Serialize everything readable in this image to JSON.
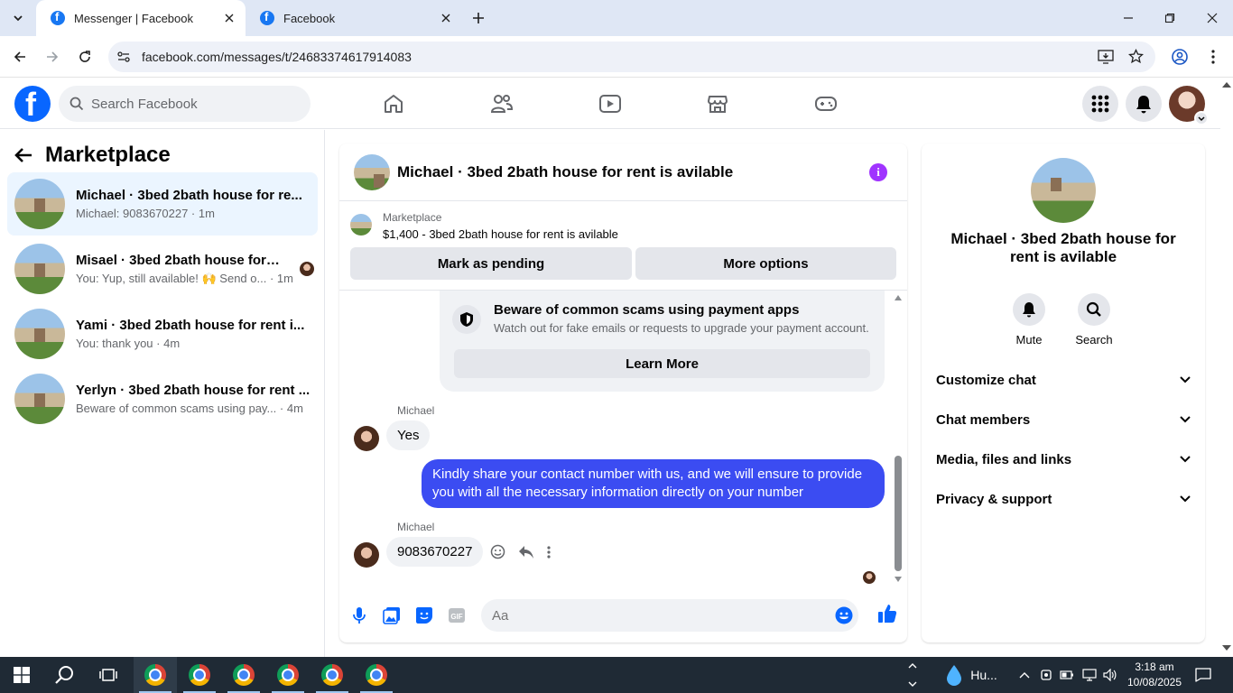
{
  "browser": {
    "tabs": [
      {
        "title": "Messenger | Facebook",
        "active": true
      },
      {
        "title": "Facebook",
        "active": false
      }
    ],
    "url": "facebook.com/messages/t/24683374617914083"
  },
  "header": {
    "search_placeholder": "Search Facebook"
  },
  "sidebar": {
    "title": "Marketplace",
    "conversations": [
      {
        "name": "Michael · 3bed 2bath house for re...",
        "preview": "Michael: 9083670227 · 1m",
        "selected": true
      },
      {
        "name": "Misael · 3bed 2bath house for r...",
        "preview": "You: Yup, still available! 🙌 Send o... · 1m",
        "selected": false
      },
      {
        "name": "Yami · 3bed 2bath house for rent i...",
        "preview": "You: thank you · 4m",
        "selected": false
      },
      {
        "name": "Yerlyn · 3bed 2bath house for rent ...",
        "preview": "Beware of common scams using pay... · 4m",
        "selected": false
      }
    ]
  },
  "chat": {
    "title": "Michael · 3bed 2bath house for rent is avilable",
    "marketplace_label": "Marketplace",
    "listing": "$1,400 - 3bed 2bath house for rent is avilable",
    "mark_pending": "Mark as pending",
    "more_options": "More options",
    "scam_title": "Beware of common scams using payment apps",
    "scam_body": "Watch out for fake emails or requests to upgrade your payment account.",
    "learn_more": "Learn More",
    "messages": [
      {
        "sender": "Michael",
        "text": "Yes",
        "direction": "in"
      },
      {
        "sender": "",
        "text": "Kindly share your contact number with us, and we will ensure to provide you with all the necessary information directly on your number",
        "direction": "out"
      },
      {
        "sender": "Michael",
        "text": "9083670227",
        "direction": "in"
      }
    ],
    "input_placeholder": "Aa"
  },
  "details": {
    "name": "Michael · 3bed 2bath house for rent is avilable",
    "mute": "Mute",
    "search": "Search",
    "sections": [
      "Customize chat",
      "Chat members",
      "Media, files and links",
      "Privacy & support"
    ]
  },
  "taskbar": {
    "weather": "Hu...",
    "time": "3:18 am",
    "date": "10/08/2025"
  },
  "colors": {
    "accent": "#0866ff",
    "outgoing_bubble": "#3b4cf2",
    "info": "#a033ff"
  }
}
